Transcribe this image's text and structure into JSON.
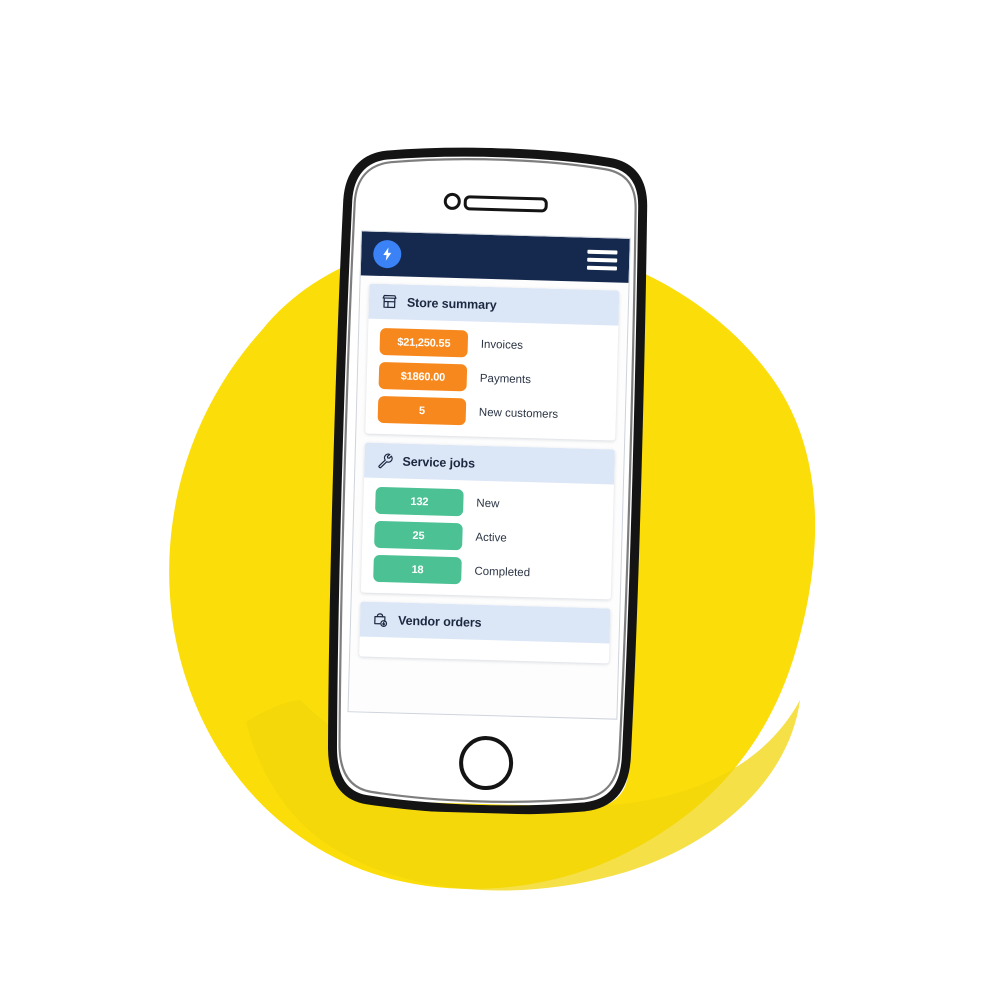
{
  "scene": {
    "background_color": "#ffffff",
    "blob_color": "#FBDD0A",
    "blob_highlight_color": "#F4D90B",
    "phone_ink_color": "#141414",
    "phone_body_color": "#ffffff"
  },
  "phone": {
    "camera_icon": "camera-dot-icon",
    "speaker_icon": "speaker-slot-icon",
    "home_button_icon": "home-button-icon"
  },
  "app": {
    "navbar": {
      "logo_icon": "lightning-bolt-logo-icon",
      "logo_circle_color": "#3b82f6",
      "background_color": "#15294f",
      "menu_icon": "hamburger-menu-icon"
    },
    "cards": [
      {
        "id": "store-summary",
        "icon": "storefront-icon",
        "title": "Store summary",
        "badge_color": "#f7881d",
        "stats": [
          {
            "value": "$21,250.55",
            "label": "Invoices"
          },
          {
            "value": "$1860.00",
            "label": "Payments"
          },
          {
            "value": "5",
            "label": "New customers"
          }
        ]
      },
      {
        "id": "service-jobs",
        "icon": "wrench-icon",
        "title": "Service jobs",
        "badge_color": "#4cc194",
        "stats": [
          {
            "value": "132",
            "label": "New"
          },
          {
            "value": "25",
            "label": "Active"
          },
          {
            "value": "18",
            "label": "Completed"
          }
        ]
      },
      {
        "id": "vendor-orders",
        "icon": "package-download-icon",
        "title": "Vendor orders",
        "badge_color": "#f7881d",
        "stats": []
      }
    ]
  }
}
